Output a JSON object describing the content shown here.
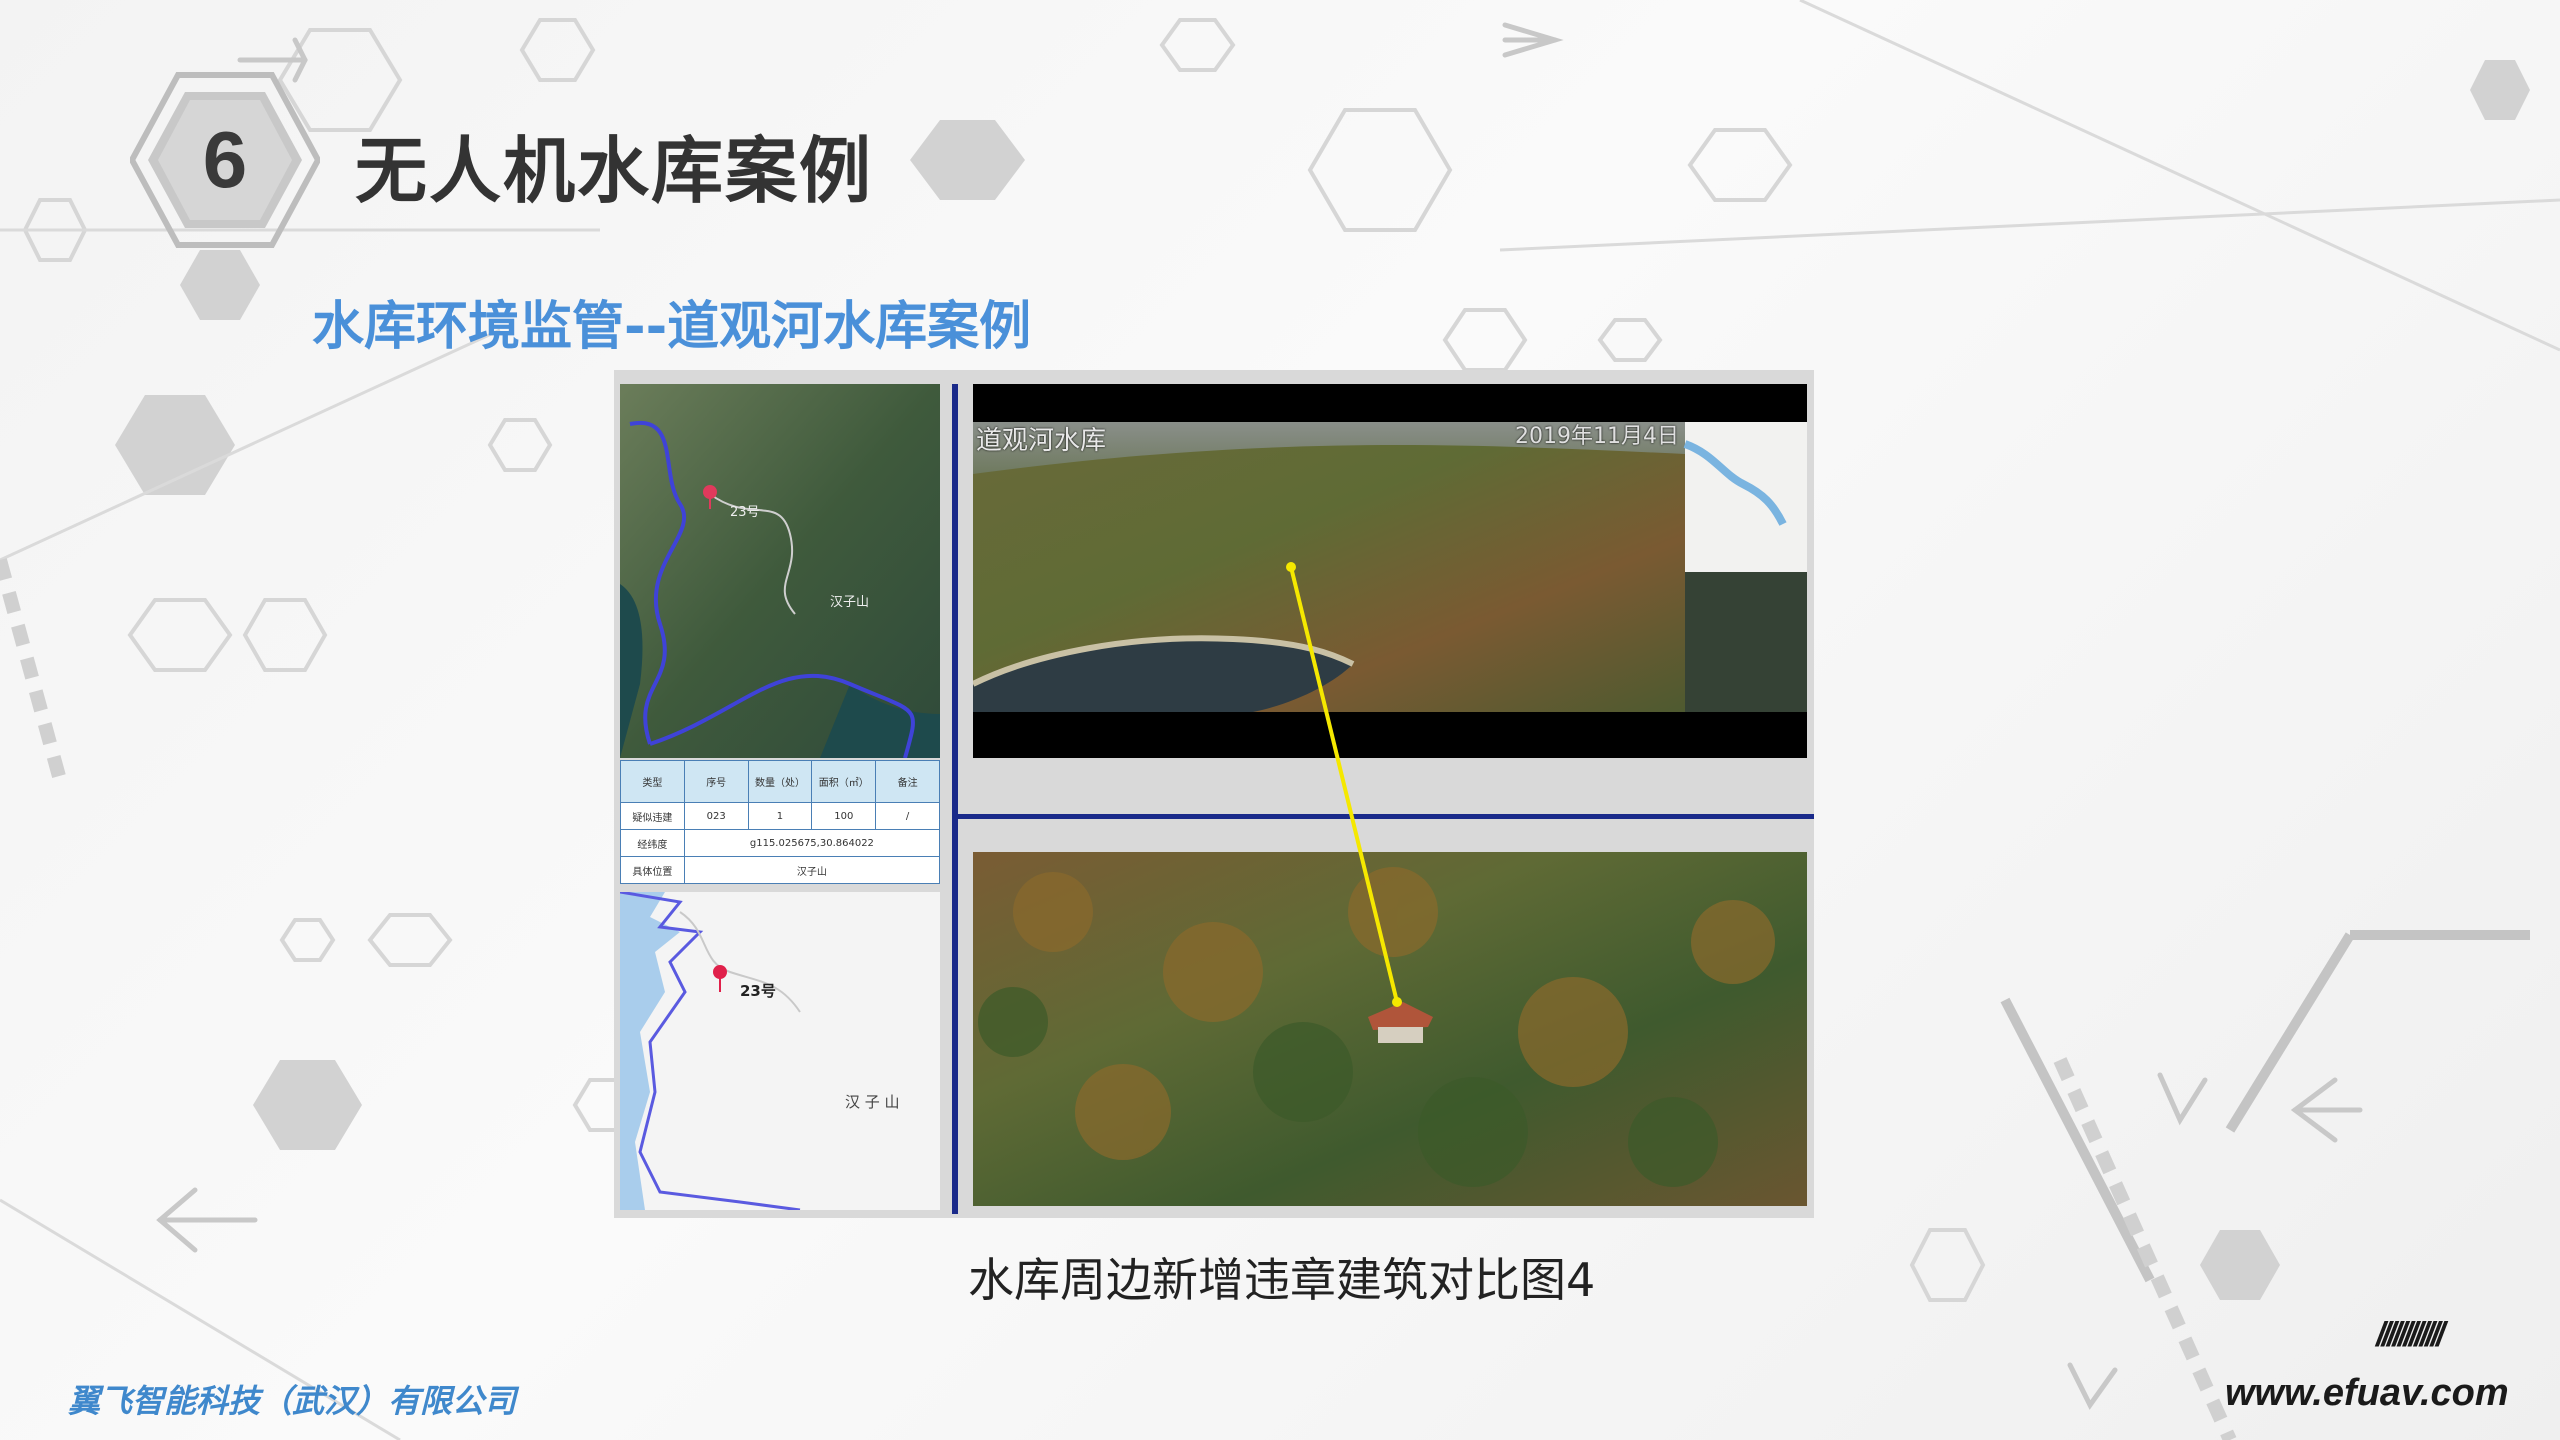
{
  "header": {
    "section_number": "6",
    "title": "无人机水库案例",
    "subtitle": "水库环境监管--道观河水库案例"
  },
  "map_top": {
    "marker_label": "23号",
    "place_label": "汉子山"
  },
  "info_table": {
    "headers": [
      "类型",
      "序号",
      "数量（处）",
      "面积（㎡）",
      "备注"
    ],
    "row1": [
      "疑似违建",
      "023",
      "1",
      "100",
      "/"
    ],
    "coord_label": "经纬度",
    "coord_value": "g115.025675,30.864022",
    "location_label": "具体位置",
    "location_value": "汉子山"
  },
  "map_bottom": {
    "marker_label": "23号",
    "place_label": "汉 子 山"
  },
  "photo_top": {
    "overlay_left": "道观河水库",
    "overlay_right": "2019年11月4日"
  },
  "caption": "水库周边新增违章建筑对比图4",
  "footer": {
    "company": "翼飞智能科技（武汉）有限公司",
    "website": "www.efuav.com",
    "slashes": "////////////"
  },
  "colors": {
    "title": "#333333",
    "subtitle": "#4a90d9",
    "divider": "#1a2a8a",
    "company": "#3f88cc",
    "connector_line": "#f5e800"
  }
}
